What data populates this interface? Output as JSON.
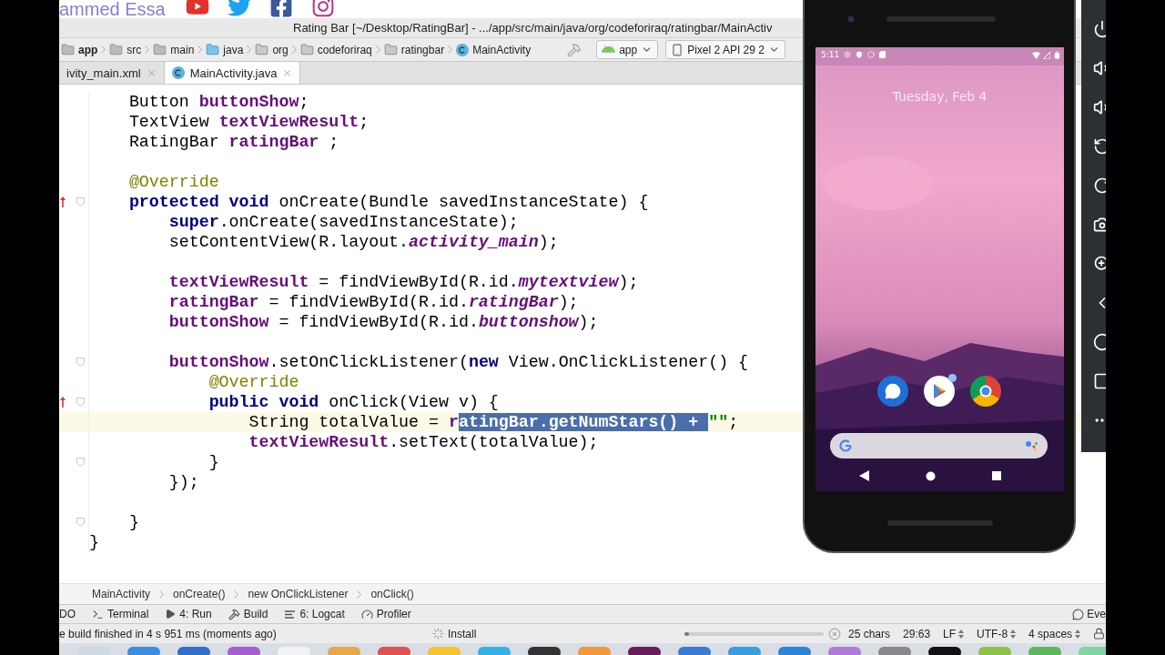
{
  "banner": {
    "channel": "ammed Essa",
    "social": [
      {
        "kind": "youtube"
      },
      {
        "kind": "twitter"
      },
      {
        "kind": "facebook"
      },
      {
        "kind": "instagram"
      }
    ]
  },
  "window": {
    "title": "Rating Bar [~/Desktop/RatingBar] - .../app/src/main/java/org/codeforiraq/ratingbar/MainActiv"
  },
  "nav_bar": {
    "path": [
      {
        "label": "app",
        "kind": "module"
      },
      {
        "label": "src",
        "kind": "folder"
      },
      {
        "label": "main",
        "kind": "folder"
      },
      {
        "label": "java",
        "kind": "source"
      },
      {
        "label": "org",
        "kind": "package"
      },
      {
        "label": "codeforiraq",
        "kind": "package"
      },
      {
        "label": "ratingbar",
        "kind": "package"
      },
      {
        "label": "MainActivity",
        "kind": "class"
      }
    ],
    "run_config": "app",
    "device": "Pixel 2 API 29 2"
  },
  "tabs": [
    {
      "label": "ivity_main.xml",
      "kind": "xml",
      "selected": false
    },
    {
      "label": "MainActivity.java",
      "kind": "class",
      "selected": true
    }
  ],
  "editor": {
    "lines": [
      {
        "current": false,
        "override": false,
        "fold": false,
        "tokens": [
          {
            "kind": "plain",
            "text": "    Button "
          },
          {
            "kind": "field",
            "text": "buttonShow"
          },
          {
            "kind": "plain",
            "text": ";"
          }
        ]
      },
      {
        "current": false,
        "override": false,
        "fold": false,
        "tokens": [
          {
            "kind": "plain",
            "text": "    TextView "
          },
          {
            "kind": "field",
            "text": "textViewResult"
          },
          {
            "kind": "plain",
            "text": ";"
          }
        ]
      },
      {
        "current": false,
        "override": false,
        "fold": false,
        "tokens": [
          {
            "kind": "plain",
            "text": "    RatingBar "
          },
          {
            "kind": "field",
            "text": "ratingBar"
          },
          {
            "kind": "plain",
            "text": " ;"
          }
        ]
      },
      {
        "current": false,
        "override": false,
        "fold": false
      },
      {
        "current": false,
        "override": false,
        "fold": false,
        "tokens": [
          {
            "kind": "annotation",
            "text": "    @Override"
          }
        ]
      },
      {
        "current": false,
        "override": true,
        "fold": true,
        "tokens": [
          {
            "kind": "keyword",
            "text": "    protected void"
          },
          {
            "kind": "plain",
            "text": " onCreate(Bundle savedInstanceState) {"
          }
        ]
      },
      {
        "current": false,
        "override": false,
        "fold": false,
        "tokens": [
          {
            "kind": "keyword",
            "text": "        super"
          },
          {
            "kind": "plain",
            "text": ".onCreate(savedInstanceState);"
          }
        ]
      },
      {
        "current": false,
        "override": false,
        "fold": false,
        "tokens": [
          {
            "kind": "plain",
            "text": "        setContentView(R.layout."
          },
          {
            "kind": "static",
            "text": "activity_main"
          },
          {
            "kind": "plain",
            "text": ");"
          }
        ]
      },
      {
        "current": false,
        "override": false,
        "fold": false
      },
      {
        "current": false,
        "override": false,
        "fold": false,
        "tokens": [
          {
            "kind": "field",
            "text": "        textViewResult"
          },
          {
            "kind": "plain",
            "text": " = findViewById(R.id."
          },
          {
            "kind": "static",
            "text": "mytextview"
          },
          {
            "kind": "plain",
            "text": ");"
          }
        ]
      },
      {
        "current": false,
        "override": false,
        "fold": false,
        "tokens": [
          {
            "kind": "field",
            "text": "        ratingBar"
          },
          {
            "kind": "plain",
            "text": " = findViewById(R.id."
          },
          {
            "kind": "static",
            "text": "ratingBar"
          },
          {
            "kind": "plain",
            "text": ");"
          }
        ]
      },
      {
        "current": false,
        "override": false,
        "fold": false,
        "tokens": [
          {
            "kind": "field",
            "text": "        buttonShow"
          },
          {
            "kind": "plain",
            "text": " = findViewById(R.id."
          },
          {
            "kind": "static",
            "text": "buttonshow"
          },
          {
            "kind": "plain",
            "text": ");"
          }
        ]
      },
      {
        "current": false,
        "override": false,
        "fold": false
      },
      {
        "current": false,
        "override": false,
        "fold": true,
        "tokens": [
          {
            "kind": "field",
            "text": "        buttonShow"
          },
          {
            "kind": "plain",
            "text": ".setOnClickListener("
          },
          {
            "kind": "keyword",
            "text": "new"
          },
          {
            "kind": "plain",
            "text": " View.OnClickListener() {"
          }
        ]
      },
      {
        "current": false,
        "override": false,
        "fold": false,
        "tokens": [
          {
            "kind": "annotation",
            "text": "            @Override"
          }
        ]
      },
      {
        "current": false,
        "override": true,
        "fold": true,
        "tokens": [
          {
            "kind": "keyword",
            "text": "            public void"
          },
          {
            "kind": "plain",
            "text": " onClick(View v) {"
          }
        ]
      },
      {
        "current": true,
        "override": false,
        "fold": false,
        "tokens": [
          {
            "kind": "plain",
            "text": "                String totalValue = "
          },
          {
            "kind": "field",
            "text": "r"
          },
          {
            "kind": "selection",
            "text": "atingBar.getNumStars() + "
          },
          {
            "kind": "string",
            "text": "\"\""
          },
          {
            "kind": "plain",
            "text": ";"
          }
        ]
      },
      {
        "current": false,
        "override": false,
        "fold": false,
        "tokens": [
          {
            "kind": "field",
            "text": "                textViewResult"
          },
          {
            "kind": "plain",
            "text": ".setText(totalValue);"
          }
        ]
      },
      {
        "current": false,
        "override": false,
        "fold": true,
        "tokens": [
          {
            "kind": "plain",
            "text": "            }"
          }
        ]
      },
      {
        "current": false,
        "override": false,
        "fold": false,
        "tokens": [
          {
            "kind": "plain",
            "text": "        });"
          }
        ]
      },
      {
        "current": false,
        "override": false,
        "fold": false
      },
      {
        "current": false,
        "override": false,
        "fold": true,
        "tokens": [
          {
            "kind": "plain",
            "text": "    }"
          }
        ]
      },
      {
        "current": false,
        "override": false,
        "fold": false,
        "tokens": [
          {
            "kind": "plain",
            "text": "}"
          }
        ]
      }
    ]
  },
  "breadcrumbs": [
    "MainActivity",
    "onCreate()",
    "new OnClickListener",
    "onClick()"
  ],
  "tool_windows": [
    {
      "label": "DO",
      "kind": "todo"
    },
    {
      "label": "Terminal",
      "kind": "terminal"
    },
    {
      "label": "4: Run",
      "kind": "run"
    },
    {
      "label": "Build",
      "kind": "build"
    },
    {
      "label": "6: Logcat",
      "kind": "logcat"
    },
    {
      "label": "Profiler",
      "kind": "profiler"
    }
  ],
  "event_log": "Eve",
  "status_bar": {
    "message": "e build finished in 4 s 951 ms (moments ago)",
    "task": "Install",
    "progress": {
      "level": 0.03
    },
    "items": [
      {
        "text": "25 chars",
        "kind": "info"
      },
      {
        "text": "29:63",
        "kind": "info"
      },
      {
        "text": "LF",
        "kind": "selector"
      },
      {
        "text": "UTF-8",
        "kind": "selector"
      },
      {
        "text": "4 spaces",
        "kind": "selector"
      }
    ]
  },
  "phone": {
    "time": "5:11",
    "date": "Tuesday, Feb 4",
    "apps": [
      {
        "kind": "messages",
        "notification": false
      },
      {
        "kind": "store",
        "notification": true
      },
      {
        "kind": "browser",
        "notification": false
      }
    ]
  }
}
